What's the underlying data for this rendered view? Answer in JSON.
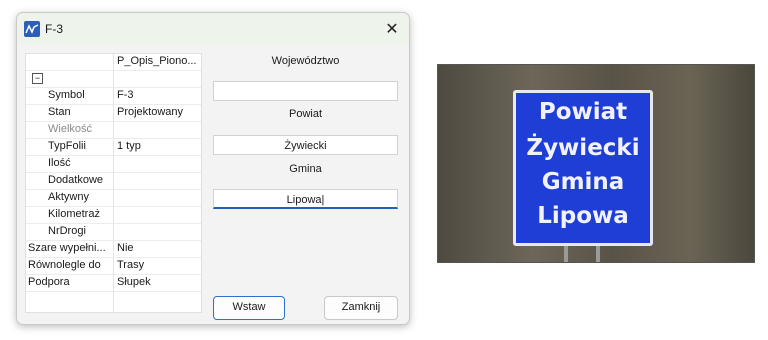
{
  "dialog": {
    "title": "F-3",
    "close_glyph": "✕",
    "icon": "app-icon"
  },
  "grid": {
    "header_value": "P_Opis_Piono...",
    "collapse_glyph": "−",
    "rows": [
      {
        "name": "Symbol",
        "value": "F-3"
      },
      {
        "name": "Stan",
        "value": "Projektowany"
      },
      {
        "name": "Wielkość",
        "value": ""
      },
      {
        "name": "TypFolii",
        "value": "1 typ"
      },
      {
        "name": "Ilość",
        "value": ""
      },
      {
        "name": "Dodatkowe",
        "value": ""
      },
      {
        "name": "Aktywny",
        "value": ""
      },
      {
        "name": "Kilometraż",
        "value": ""
      },
      {
        "name": "NrDrogi",
        "value": ""
      },
      {
        "name": "Szare wypełni...",
        "value": "Nie"
      },
      {
        "name": "Równolegle do",
        "value": "Trasy"
      },
      {
        "name": "Podpora",
        "value": "Słupek"
      }
    ]
  },
  "form": {
    "wojewodztwo_label": "Województwo",
    "wojewodztwo_value": "",
    "powiat_label": "Powiat",
    "powiat_value": "Żywiecki",
    "gmina_label": "Gmina",
    "gmina_value": "Lipowa|"
  },
  "buttons": {
    "insert": "Wstaw",
    "close": "Zamknij"
  },
  "sign": {
    "lines": [
      "Powiat",
      "Żywiecki",
      "Gmina",
      "Lipowa"
    ],
    "color": "#1f3ed6"
  }
}
